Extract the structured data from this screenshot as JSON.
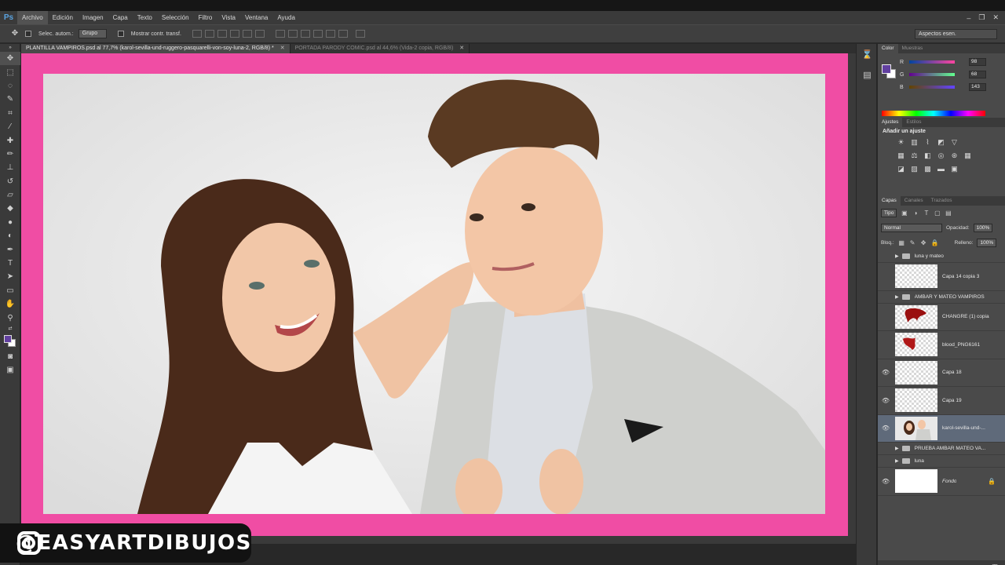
{
  "app": {
    "logo": "Ps",
    "menu": [
      "Archivo",
      "Edición",
      "Imagen",
      "Capa",
      "Texto",
      "Selección",
      "Filtro",
      "Vista",
      "Ventana",
      "Ayuda"
    ],
    "window_controls": [
      "–",
      "❐",
      "✕"
    ]
  },
  "options": {
    "auto_select_label": "Selec. autom.:",
    "auto_select_value": "Grupo",
    "show_transform_label": "Mostrar contr. transf.",
    "workspace": "Aspectos esen."
  },
  "tabs": [
    {
      "label": "PLANTILLA VAMPIROS.psd al 77,7% (karol-sevilla-und-ruggero-pasquarelli-von-soy-luna-2, RGB/8) *",
      "close": "✕",
      "active": true
    },
    {
      "label": "PORTADA PARODY COMIC.psd al 44,6% (Vida-2 copia, RGB/8)",
      "close": "✕",
      "active": false
    }
  ],
  "color_panel": {
    "tabs": [
      "Color",
      "Muestras"
    ],
    "fg_color": "#6240a0",
    "bg_color": "#ffffff",
    "r_label": "R",
    "r_value": "98",
    "g_label": "G",
    "g_value": "68",
    "b_label": "B",
    "b_value": "143"
  },
  "adjustments": {
    "tabs": [
      "Ajustes",
      "Estilos"
    ],
    "title": "Añadir un ajuste"
  },
  "layers_panel": {
    "tabs": [
      "Capas",
      "Canales",
      "Trazados"
    ],
    "filter": "Tipo",
    "blend_mode": "Normal",
    "opacity_label": "Opacidad:",
    "opacity_value": "100%",
    "lock_label": "Bloq.:",
    "fill_label": "Relleno:",
    "fill_value": "100%",
    "layers": [
      {
        "name": "luna y mateo",
        "type": "group",
        "visible": false
      },
      {
        "name": "Capa 14 copia 3",
        "type": "layer",
        "visible": false
      },
      {
        "name": "AMBAR Y MATEO VAMPIROS",
        "type": "group",
        "visible": false
      },
      {
        "name": "CHANGRE (1) copia",
        "type": "layer",
        "visible": false
      },
      {
        "name": "blood_PNG6161",
        "type": "layer",
        "visible": false
      },
      {
        "name": "Capa 18",
        "type": "layer",
        "visible": true
      },
      {
        "name": "Capa 19",
        "type": "layer",
        "visible": true
      },
      {
        "name": "karol-sevilla-und-...",
        "type": "layer",
        "visible": true,
        "selected": true
      },
      {
        "name": "PRUEBA AMBAR MATEO VA...",
        "type": "group",
        "visible": false
      },
      {
        "name": "luna",
        "type": "group",
        "visible": false
      },
      {
        "name": "Fondo",
        "type": "layer",
        "visible": true
      }
    ]
  },
  "watermark": {
    "handle": "@EASYARTDIBUJOS"
  },
  "canvas": {
    "border_color": "#f04da4"
  }
}
